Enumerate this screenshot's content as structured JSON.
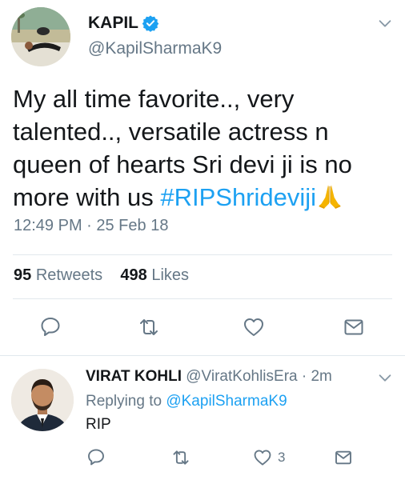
{
  "main_tweet": {
    "author_name": "KAPIL",
    "handle": "@KapilSharmaK9",
    "text_plain": "My all time favorite.., very talented.., versatile actress n queen of hearts Sri devi ji is no more with us ",
    "hashtag": "#RIPShrideviji",
    "emoji": "folded-hands-emoji",
    "timestamp": "12:49 PM · 25 Feb 18",
    "retweets_count": "95",
    "retweets_label": "Retweets",
    "likes_count": "498",
    "likes_label": "Likes"
  },
  "reply": {
    "author_name": "VIRAT KOHLI",
    "meta": "@ViratKohlisEra · 2m",
    "replying_prefix": "Replying to",
    "replying_to": "@KapilSharmaK9",
    "text": "RIP",
    "like_count": "3"
  },
  "icons": {
    "verified": "verified-badge-icon",
    "more": "chevron-down-icon",
    "reply": "reply-icon",
    "retweet": "retweet-icon",
    "like": "heart-icon",
    "share": "envelope-icon"
  },
  "colors": {
    "accent": "#1da1f2",
    "text": "#14171a",
    "muted": "#657786",
    "divider": "#e1e8ed",
    "icon": "#657786",
    "emoji": "#f5b400"
  }
}
